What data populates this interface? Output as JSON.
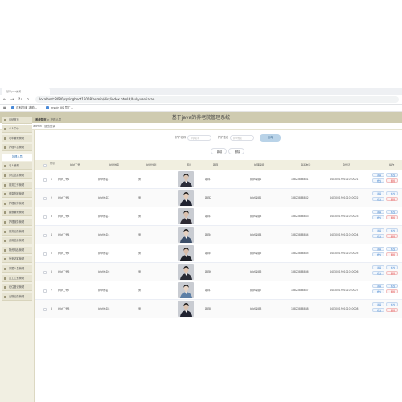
{
  "browser": {
    "tab_label": "基于java的养...",
    "url": "localhost:8080/springboot15008/admin/dist/index.html#/huliyuanjiaran",
    "bookmarks": [
      "百科知道 求助...",
      "Inspin IIS 员工..."
    ]
  },
  "app": {
    "title": "基于java的养老院管理系统",
    "user_text": "管理员 admin · 退出登录"
  },
  "sidebar": {
    "items": [
      {
        "label": "系统首页"
      },
      {
        "label": "个人中心"
      },
      {
        "label": "老年管理管理"
      },
      {
        "label": "护理人员管理"
      },
      {
        "label": "护理人员",
        "sub": true
      },
      {
        "label": "老人管理"
      },
      {
        "label": "床位信息管理"
      },
      {
        "label": "服务工作管理"
      },
      {
        "label": "健康档案管理"
      },
      {
        "label": "护理安排管理"
      },
      {
        "label": "膳食管理管理"
      },
      {
        "label": "护理服务管理"
      },
      {
        "label": "服务记录管理"
      },
      {
        "label": "费用信息管理"
      },
      {
        "label": "物资用品管理"
      },
      {
        "label": "外来访客管理"
      },
      {
        "label": "家属人员管理"
      },
      {
        "label": "员工工资管理"
      },
      {
        "label": "在住登记管理"
      },
      {
        "label": "出院记录管理"
      }
    ]
  },
  "breadcrumb": {
    "home": "系统首页",
    "sep": ">",
    "current": "护理人员"
  },
  "search": {
    "field1_label": "护护名称",
    "field1_placeholder": "护护名称",
    "field2_label": "护护姓名",
    "field2_placeholder": "护护姓名",
    "button_label": "查询"
  },
  "actions": {
    "add_label": "新增",
    "delete_label": "删除"
  },
  "table": {
    "headers": [
      "索引",
      "护护工号",
      "护护姓名",
      "护护性别",
      "照片",
      "职称",
      "护理等级",
      "联系电话",
      "身份证",
      "操作"
    ],
    "rows": [
      {
        "index": "1",
        "id": "护护工号1",
        "name": "护护姓名1",
        "gender": "男",
        "title": "职称1",
        "level": "护护等级1",
        "phone": "13823888881",
        "idcard": "440300199101010001"
      },
      {
        "index": "2",
        "id": "护护工号2",
        "name": "护护姓名2",
        "gender": "男",
        "title": "职称2",
        "level": "护护等级2",
        "phone": "13823888882",
        "idcard": "440300199101010002"
      },
      {
        "index": "3",
        "id": "护护工号3",
        "name": "护护姓名3",
        "gender": "男",
        "title": "职称3",
        "level": "护护等级3",
        "phone": "13823888883",
        "idcard": "440300199101010003"
      },
      {
        "index": "4",
        "id": "护护工号4",
        "name": "护护姓名4",
        "gender": "男",
        "title": "职称4",
        "level": "护护等级4",
        "phone": "13823888884",
        "idcard": "440300199101010004"
      },
      {
        "index": "5",
        "id": "护护工号5",
        "name": "护护姓名5",
        "gender": "男",
        "title": "职称5",
        "level": "护护等级5",
        "phone": "13823888885",
        "idcard": "440300199101010005"
      },
      {
        "index": "6",
        "id": "护护工号6",
        "name": "护护姓名6",
        "gender": "男",
        "title": "职称6",
        "level": "护护等级6",
        "phone": "13823888886",
        "idcard": "440300199101010006"
      },
      {
        "index": "7",
        "id": "护护工号7",
        "name": "护护姓名7",
        "gender": "男",
        "title": "职称7",
        "level": "护护等级7",
        "phone": "13823888887",
        "idcard": "440300199101010007"
      },
      {
        "index": "8",
        "id": "护护工号8",
        "name": "护护姓名8",
        "gender": "男",
        "title": "职称8",
        "level": "护护等级8",
        "phone": "13823888888",
        "idcard": "440300199101010008"
      }
    ],
    "row_actions": {
      "detail": "详情",
      "edit": "修改",
      "delete": "删除"
    }
  },
  "colors": {
    "title_bar": "#cfcbb0",
    "sidebar": "#f1efe2",
    "accent": "#3a7ecb",
    "danger": "#d44444"
  }
}
